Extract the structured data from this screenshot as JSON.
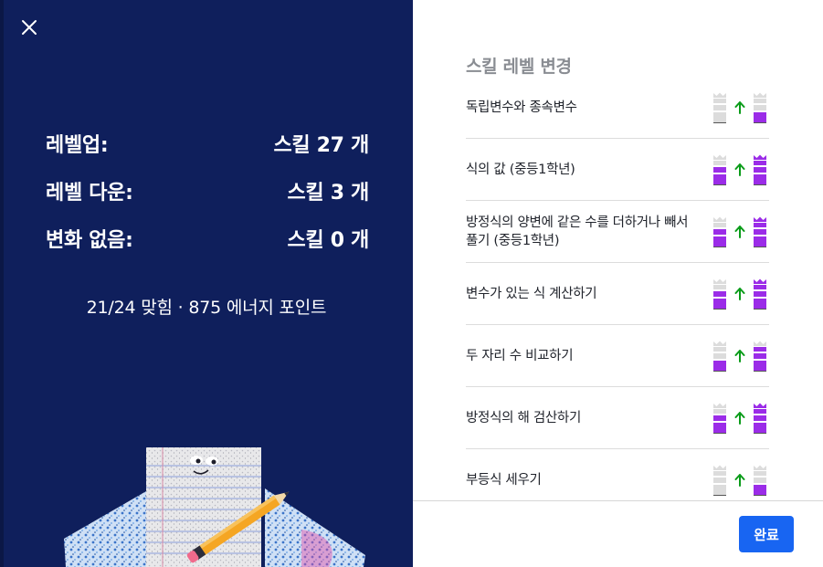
{
  "summary": {
    "level_up": {
      "label": "레벨업:",
      "value": "스킬 27 개"
    },
    "level_down": {
      "label": "레벨 다운:",
      "value": "스킬 3 개"
    },
    "no_change": {
      "label": "변화 없음:",
      "value": "스킬 0 개"
    }
  },
  "stats": "21/24 맞힘 · 875 에너지 포인트",
  "skills_panel": {
    "title": "스킬 레벨 변경",
    "skills": [
      {
        "name": "독립변수와 종속변수",
        "before": 0,
        "after": 1
      },
      {
        "name": "식의 값 (중등1학년)",
        "before": 2,
        "after": 4
      },
      {
        "name": "방정식의 양변에 같은 수를 더하거나 빼서 풀기 (중등1학년)",
        "before": 2,
        "after": 4
      },
      {
        "name": "변수가 있는 식 계산하기",
        "before": 2,
        "after": 4
      },
      {
        "name": "두 자리 수 비교하기",
        "before": 1,
        "after": 3
      },
      {
        "name": "방정식의 해 검산하기",
        "before": 2,
        "after": 4
      },
      {
        "name": "부등식 세우기",
        "before": 0,
        "after": 1
      }
    ]
  },
  "footer": {
    "done_label": "완료"
  },
  "colors": {
    "panel_bg": "#0f1f5c",
    "level_filled": "#9b2ce8",
    "level_empty": "#dcdcdc",
    "arrow_up": "#0a9c19",
    "primary_button": "#1865f2"
  },
  "icons": {
    "close": "close-icon",
    "arrow": "arrow-up-icon",
    "crown": "crown-icon"
  }
}
